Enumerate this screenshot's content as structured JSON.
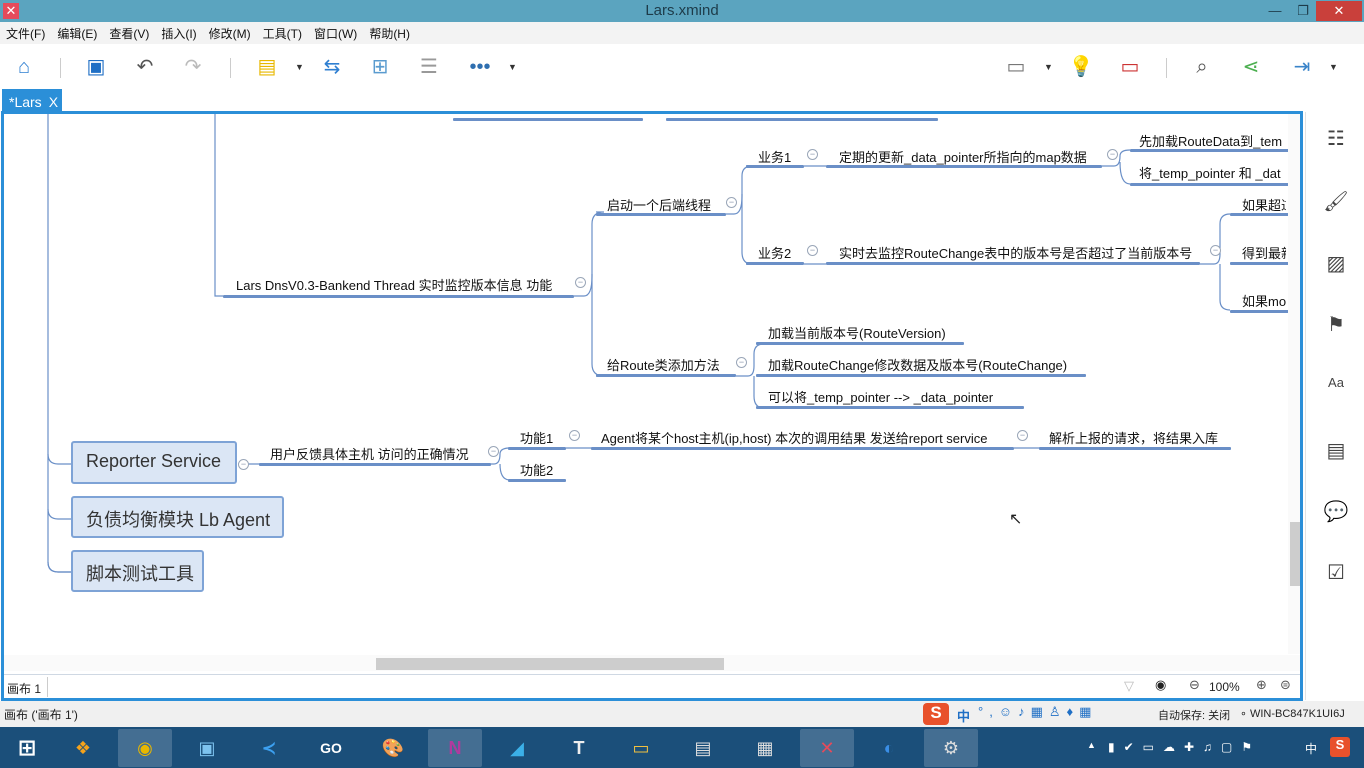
{
  "window": {
    "title": "Lars.xmind",
    "minimize": "—",
    "restore": "❐",
    "close": "✕"
  },
  "menu": [
    "文件(F)",
    "编辑(E)",
    "查看(V)",
    "插入(I)",
    "修改(M)",
    "工具(T)",
    "窗口(W)",
    "帮助(H)"
  ],
  "toolbar": {
    "icons": [
      "home-icon",
      "save-icon",
      "undo-icon",
      "redo-icon",
      "topic-icon",
      "relationship-icon",
      "boundary-icon",
      "summary-icon",
      "more-icon",
      "presentation-icon",
      "idea-icon",
      "layout-icon",
      "search-icon",
      "share-icon",
      "export-icon"
    ]
  },
  "tab": {
    "label": "*Lars",
    "close": "X"
  },
  "mindmap": {
    "main_branch": "Lars DnsV0.3-Bankend Thread 实时监控版本信息 功能",
    "thread": "启动一个后端线程",
    "task1": "业务1",
    "task1_desc": "定期的更新_data_pointer所指向的map数据",
    "task1_sub": [
      "先加载RouteData到_tem",
      "将_temp_pointer 和 _dat"
    ],
    "task2": "业务2",
    "task2_desc": "实时去监控RouteChange表中的版本号是否超过了当前版本号",
    "task2_sub": [
      "如果超过",
      "得到最新",
      "如果mo"
    ],
    "route_methods": "给Route类添加方法",
    "route_sub": [
      "加载当前版本号(RouteVersion)",
      "加载RouteChange修改数据及版本号(RouteChange)",
      "可以将_temp_pointer --> _data_pointer"
    ],
    "reporter": "Reporter Service",
    "reporter_desc": "用户反馈具体主机 访问的正确情况",
    "func1": "功能1",
    "func1_desc": "Agent将某个host主机(ip,host) 本次的调用结果 发送给report service",
    "func1_sub": "解析上报的请求，将结果入库",
    "func2": "功能2",
    "lb_agent": "负债均衡模块 Lb Agent",
    "test_tool": "脚本测试工具"
  },
  "sheet": {
    "name": "画布 1",
    "zoom": "100%"
  },
  "status": {
    "left": "画布 ('画布 1')",
    "autosave": "自动保存: 关闭",
    "host": "WIN-BC847K1UI6J"
  },
  "ime": {
    "lang": "中"
  },
  "taskbar": {
    "tray_lang": "中"
  },
  "colors": {
    "accent": "#2b8fd8",
    "branch_line": "#6a8fc7",
    "topic_fill": "#dbe6f5",
    "taskbar": "#1b4f7a"
  }
}
